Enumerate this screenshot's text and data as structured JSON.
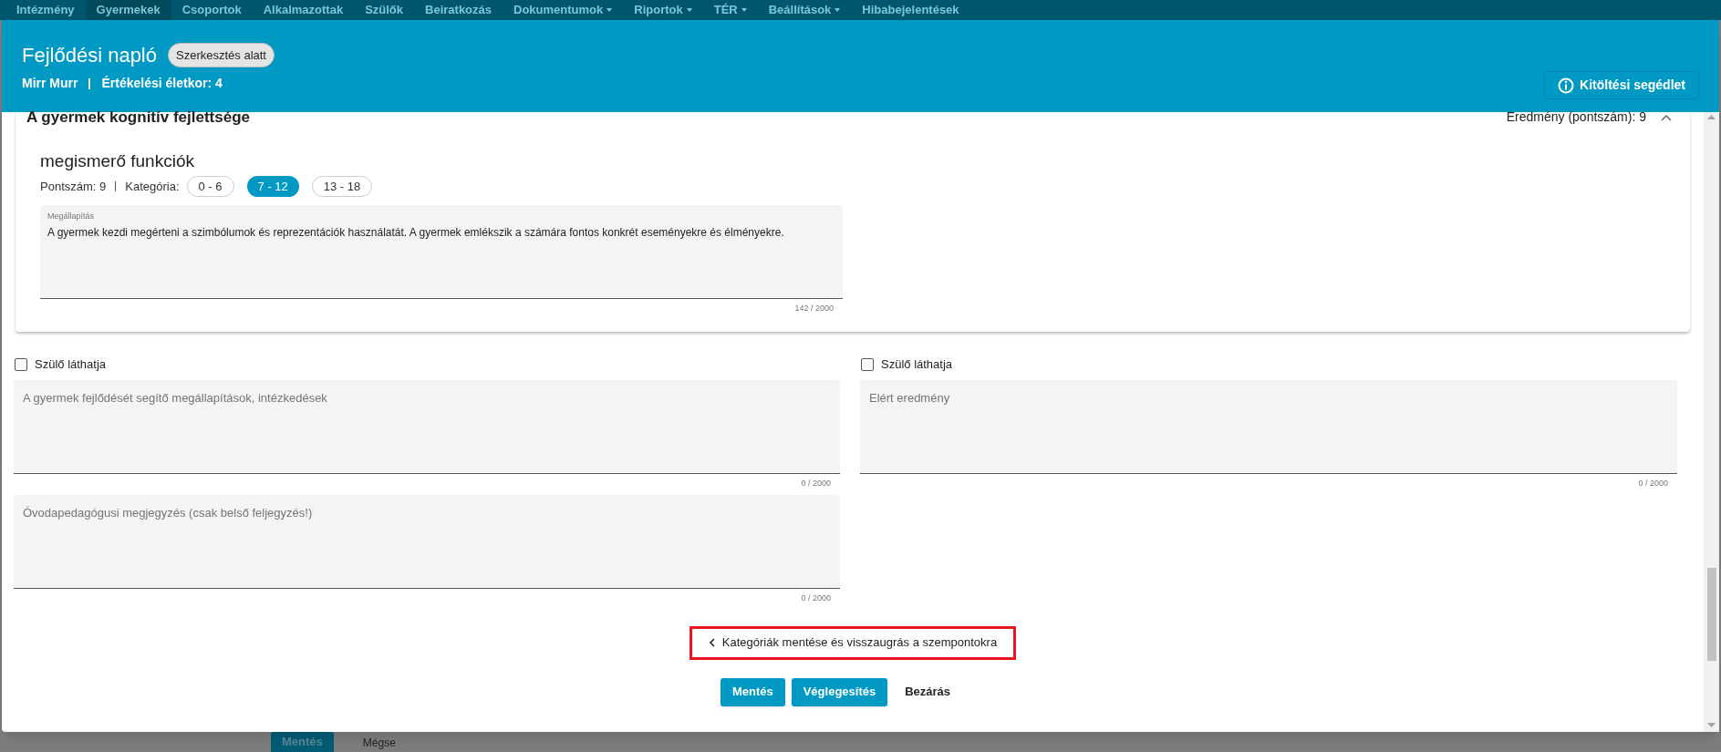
{
  "nav": [
    {
      "label": "Intézmény",
      "selected": false,
      "dropdown": false
    },
    {
      "label": "Gyermekek",
      "selected": true,
      "dropdown": false
    },
    {
      "label": "Csoportok",
      "selected": false,
      "dropdown": false
    },
    {
      "label": "Alkalmazottak",
      "selected": false,
      "dropdown": false
    },
    {
      "label": "Szülők",
      "selected": false,
      "dropdown": false
    },
    {
      "label": "Beiratkozás",
      "selected": false,
      "dropdown": false
    },
    {
      "label": "Dokumentumok",
      "selected": false,
      "dropdown": true
    },
    {
      "label": "Riportok",
      "selected": false,
      "dropdown": true
    },
    {
      "label": "TÉR",
      "selected": false,
      "dropdown": true
    },
    {
      "label": "Beállítások",
      "selected": false,
      "dropdown": true
    },
    {
      "label": "Hibabejelentések",
      "selected": false,
      "dropdown": false
    }
  ],
  "dialog": {
    "title": "Fejlődési napló",
    "status_badge": "Szerkesztés alatt",
    "child_name": "Mirr Murr",
    "age_label": "Értékelési életkor: 4",
    "help_button": "Kitöltési segédlet",
    "section": {
      "title": "A gyermek kognitív fejlettsége",
      "result": "Eredmény (pontszám): 9",
      "expanded": true,
      "subsection": {
        "title": "megismerő funkciók",
        "score": "Pontszám: 9",
        "category_label": "Kategória:",
        "categories": [
          {
            "label": "0 - 6",
            "selected": false
          },
          {
            "label": "7 - 12",
            "selected": true
          },
          {
            "label": "13 - 18",
            "selected": false
          }
        ],
        "finding": {
          "label": "Megállapítás",
          "value": "A gyermek kezdi megérteni a szimbólumok és reprezentációk használatát. A gyermek emlékszik a számára fontos konkrét eseményekre és élményekre.",
          "counter": "142 / 2000"
        }
      }
    },
    "left_column": {
      "checkbox": {
        "label": "Szülő láthatja",
        "checked": false
      },
      "fields": [
        {
          "placeholder": "A gyermek fejlődését segítő megállapítások, intézkedések",
          "counter": "0 / 2000"
        },
        {
          "placeholder": "Óvodapedagógusi megjegyzés (csak belső feljegyzés!)",
          "counter": "0 / 2000"
        }
      ]
    },
    "right_column": {
      "checkbox": {
        "label": "Szülő láthatja",
        "checked": false
      },
      "fields": [
        {
          "placeholder": "Elért eredmény",
          "counter": "0 / 2000"
        }
      ]
    },
    "back_button": "Kategóriák mentése és visszaugrás a szempontokra",
    "footer": [
      {
        "label": "Mentés",
        "kind": "primary"
      },
      {
        "label": "Véglegesítés",
        "kind": "primary"
      },
      {
        "label": "Bezárás",
        "kind": "text"
      }
    ]
  },
  "background_buttons": [
    {
      "label": "Mentés",
      "kind": "primary"
    },
    {
      "label": "Mégse",
      "kind": "text"
    }
  ]
}
